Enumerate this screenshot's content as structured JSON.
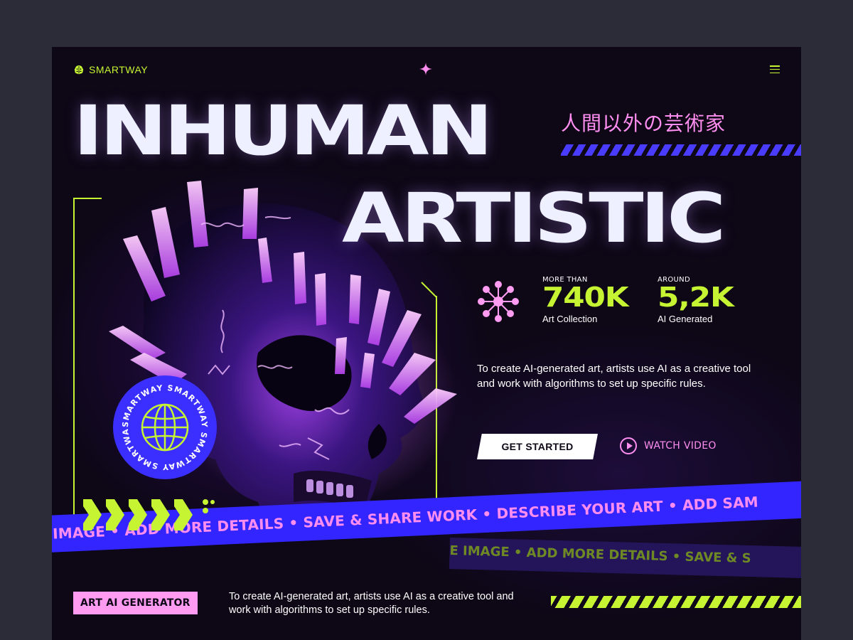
{
  "brand": {
    "name": "SMARTWAY"
  },
  "hero": {
    "title_line1": "INHUMAN",
    "title_line2": "ARTISTIC",
    "japanese": "人間以外の芸術家"
  },
  "stats": [
    {
      "prefix": "MORE THAN",
      "value": "740K",
      "label": "Art Collection"
    },
    {
      "prefix": "AROUND",
      "value": "5,2K",
      "label": "AI Generated"
    }
  ],
  "description": "To create AI-generated art, artists use AI as a creative tool and work with algorithms to set up specific rules.",
  "buttons": {
    "get_started": "GET STARTED",
    "watch_video": "WATCH VIDEO"
  },
  "badge": {
    "ring_text": "SMARTWAY SMARTWAY SMARTWAY SMARTWAY"
  },
  "ribbon_front": "IMAGE • ADD MORE DETAILS • SAVE & SHARE WORK • DESCRIBE YOUR ART • ADD SAM",
  "ribbon_back": "E IMAGE • ADD MORE DETAILS • SAVE & S",
  "footer": {
    "tag": "ART AI GENERATOR",
    "text": "To create AI-generated art, artists use AI as a creative tool and work with algorithms to set up specific rules."
  },
  "colors": {
    "lime": "#c6f432",
    "pink": "#ff8ef0",
    "blue": "#3325ff",
    "background": "#0d0716"
  }
}
